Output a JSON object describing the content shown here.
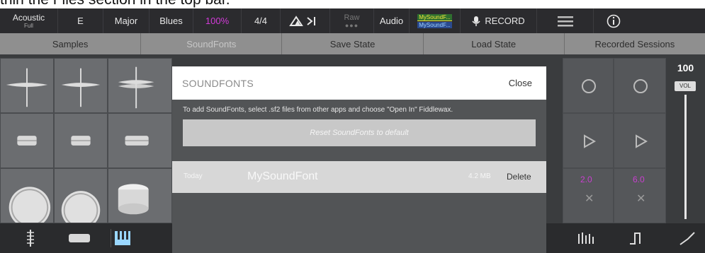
{
  "caption": "thin the Files section in the top bar.",
  "topbar": {
    "kit_label": "Acoustic",
    "kit_sub": "Full",
    "key": "E",
    "scale": "Major",
    "mode": "Blues",
    "percent": "100%",
    "time_sig": "4/4",
    "raw_label": "Raw",
    "audio_label": "Audio",
    "sound_slot1": "MySoundF...",
    "sound_slot2": "MySoundF...",
    "record_label": "RECORD",
    "colors": {
      "pink": "#d23bd8",
      "bar_bg": "#2b2b2e"
    }
  },
  "nav": {
    "tabs": [
      {
        "label": "Samples"
      },
      {
        "label": "SoundFonts"
      },
      {
        "label": "Save State"
      },
      {
        "label": "Load State"
      },
      {
        "label": "Recorded Sessions"
      }
    ],
    "active_index": 1
  },
  "volume": {
    "value": "100",
    "label": "VOL"
  },
  "pads": {
    "value_a": "2.0",
    "value_b": "6.0"
  },
  "modal": {
    "title": "SOUNDFONTS",
    "close_label": "Close",
    "message": "To add SoundFonts, select .sf2 files from other apps and choose \"Open In\" Fiddlewax.",
    "reset_label": "Reset SoundFonts to default",
    "items": [
      {
        "date": "Today",
        "name": "MySoundFont",
        "size": "4.2 MB",
        "delete_label": "Delete"
      }
    ]
  }
}
